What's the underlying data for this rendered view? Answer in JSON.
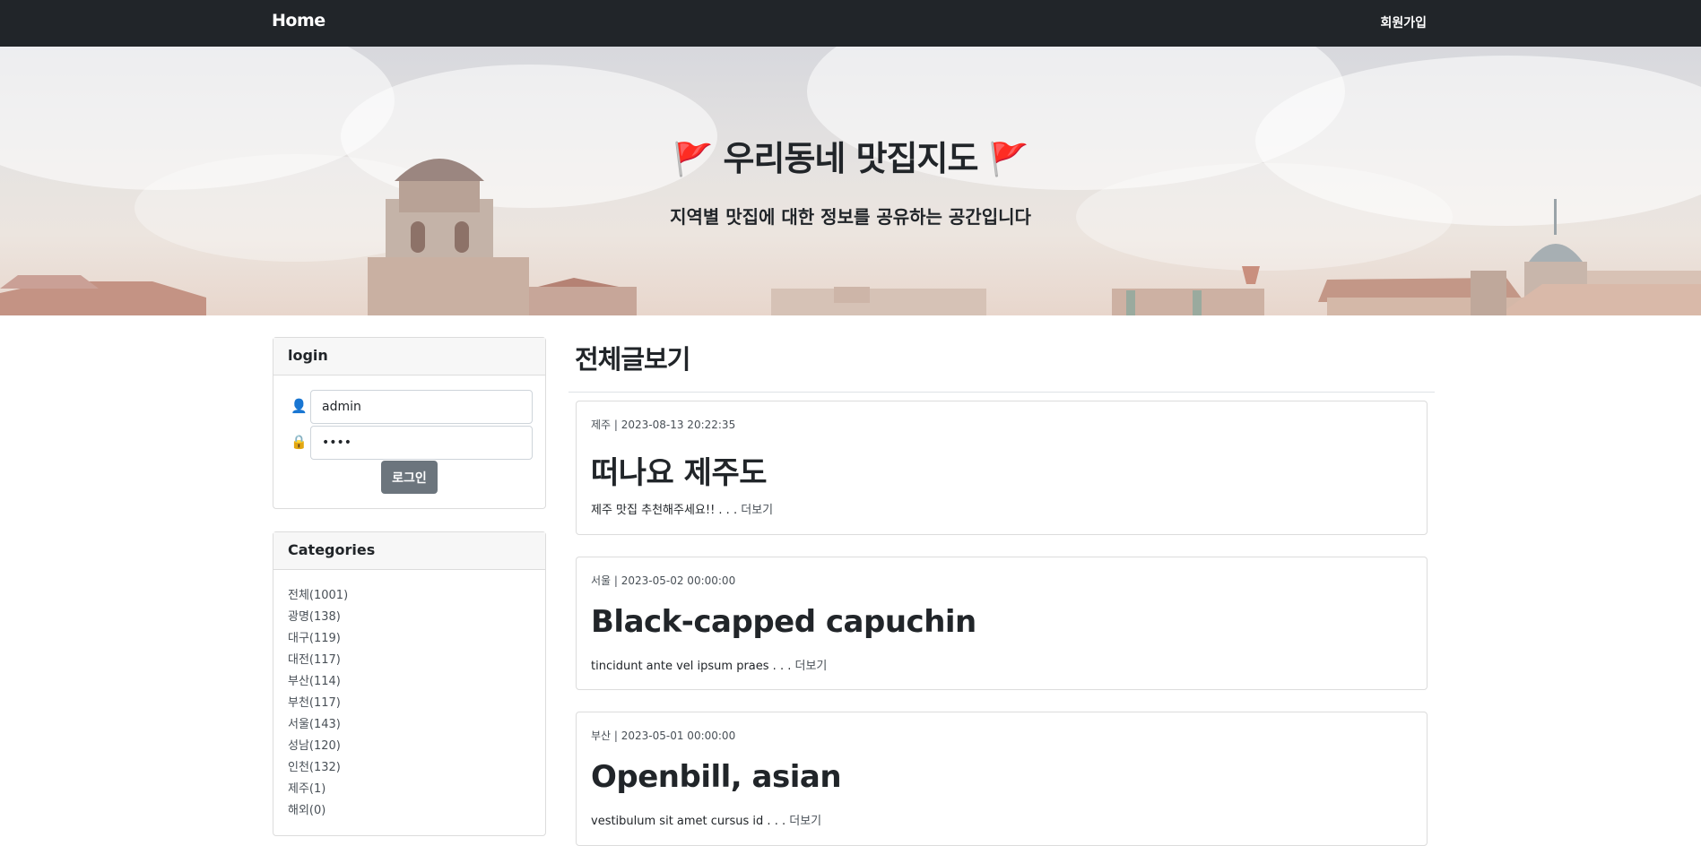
{
  "nav": {
    "brand": "Home",
    "signup": "회원가입"
  },
  "hero": {
    "flag": "🚩",
    "title": "우리동네 맛집지도",
    "subtitle": "지역별 맛집에 대한 정보를 공유하는 공간입니다"
  },
  "login": {
    "header": "login",
    "user_icon": "user-icon",
    "lock_icon": "lock-icon",
    "username": "admin",
    "password": "••••",
    "button": "로그인"
  },
  "categories": {
    "header": "Categories",
    "items": [
      "전체(1001)",
      "광명(138)",
      "대구(119)",
      "대전(117)",
      "부산(114)",
      "부천(117)",
      "서울(143)",
      "성남(120)",
      "인천(132)",
      "제주(1)",
      "해외(0)"
    ]
  },
  "main": {
    "title": "전체글보기",
    "posts": [
      {
        "meta": "제주 | 2023-08-13 20:22:35",
        "title": "떠나요 제주도",
        "excerpt": "제주 맛집 추천해주세요!! . . .",
        "more": "더보기"
      },
      {
        "meta": "서울 | 2023-05-02 00:00:00",
        "title": "Black-capped capuchin",
        "excerpt": "tincidunt ante vel ipsum praes . . .",
        "more": "더보기"
      },
      {
        "meta": "부산 | 2023-05-01 00:00:00",
        "title": "Openbill, asian",
        "excerpt": "vestibulum sit amet cursus id . . .",
        "more": "더보기"
      }
    ]
  },
  "colors": {
    "navbar": "#212529",
    "flag": "#e53935",
    "button": "#6c757d"
  }
}
